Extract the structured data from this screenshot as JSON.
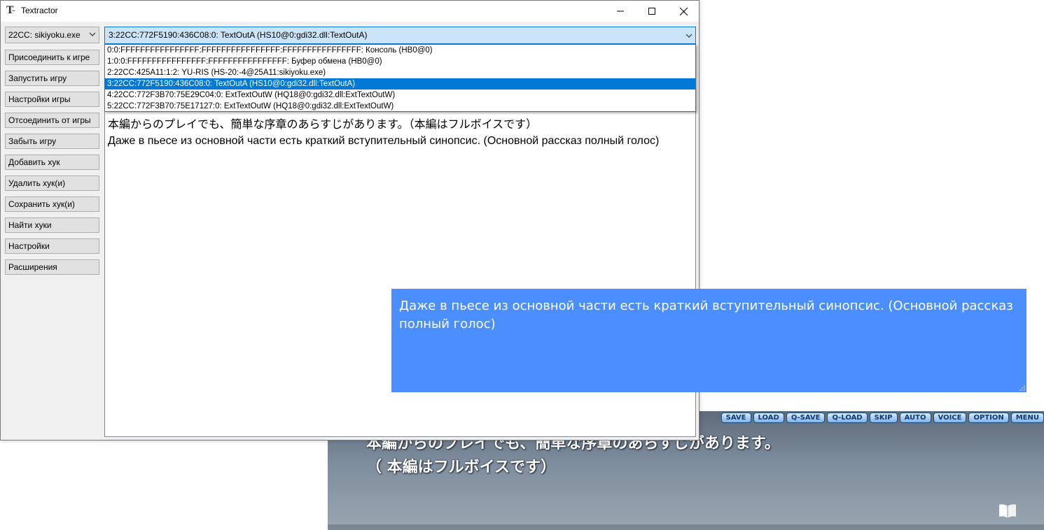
{
  "textractor": {
    "title": "Textractor",
    "process_selected": "22CC: sikiyoku.exe",
    "buttons": [
      "Присоединить к игре",
      "Запустить игру",
      "Настройки игры",
      "Отсоединить от игры",
      "Забыть игру",
      "Добавить хук",
      "Удалить хук(и)",
      "Сохранить хук(и)",
      "Найти хуки",
      "Настройки",
      "Расширения"
    ],
    "hook_selected": "3:22CC:772F5190:436C08:0: TextOutA (HS10@0:gdi32.dll:TextOutA)",
    "hooks": [
      "0:0:FFFFFFFFFFFFFFFF:FFFFFFFFFFFFFFFF:FFFFFFFFFFFFFFFF: Консоль (HB0@0)",
      "1:0:0:FFFFFFFFFFFFFFFF:FFFFFFFFFFFFFFFF: Буфер обмена (HB0@0)",
      "2:22CC:425A11:1:2: YU-RIS (HS-20:-4@25A11:sikiyoku.exe)",
      "3:22CC:772F5190:436C08:0: TextOutA (HS10@0:gdi32.dll:TextOutA)",
      "4:22CC:772F3B70:75E29C04:0: ExtTextOutW (HQ18@0:gdi32.dll:ExtTextOutW)",
      "5:22CC:772F3B70:75E17127:0: ExtTextOutW (HQ18@0:gdi32.dll:ExtTextOutW)"
    ],
    "selected_hook_index": 3,
    "text_line_jp": "本編からのプレイでも、簡単な序章のあらすじがあります。（本編はフルボイスです）",
    "text_line_ru": "Даже в пьесе из основной части есть краткий вступительный синопсис. (Основной рассказ полный голос)"
  },
  "overlay": {
    "text": "Даже в пьесе из основной части есть краткий вступительный синопсис. (Основной рассказ полный голос)",
    "background": "#4b8eff"
  },
  "game": {
    "menu": [
      "SAVE",
      "LOAD",
      "Q-SAVE",
      "Q-LOAD",
      "SKIP",
      "AUTO",
      "VOICE",
      "OPTION",
      "MENU"
    ],
    "line1": "本編からのプレイでも、簡単な序章のあらすじがあります。",
    "line2": "（ 本編はフルボイスです）"
  },
  "icons": {
    "app": "textractor-icon",
    "minimize": "minimize-icon",
    "maximize": "maximize-icon",
    "close": "close-icon",
    "book": "book-icon"
  }
}
